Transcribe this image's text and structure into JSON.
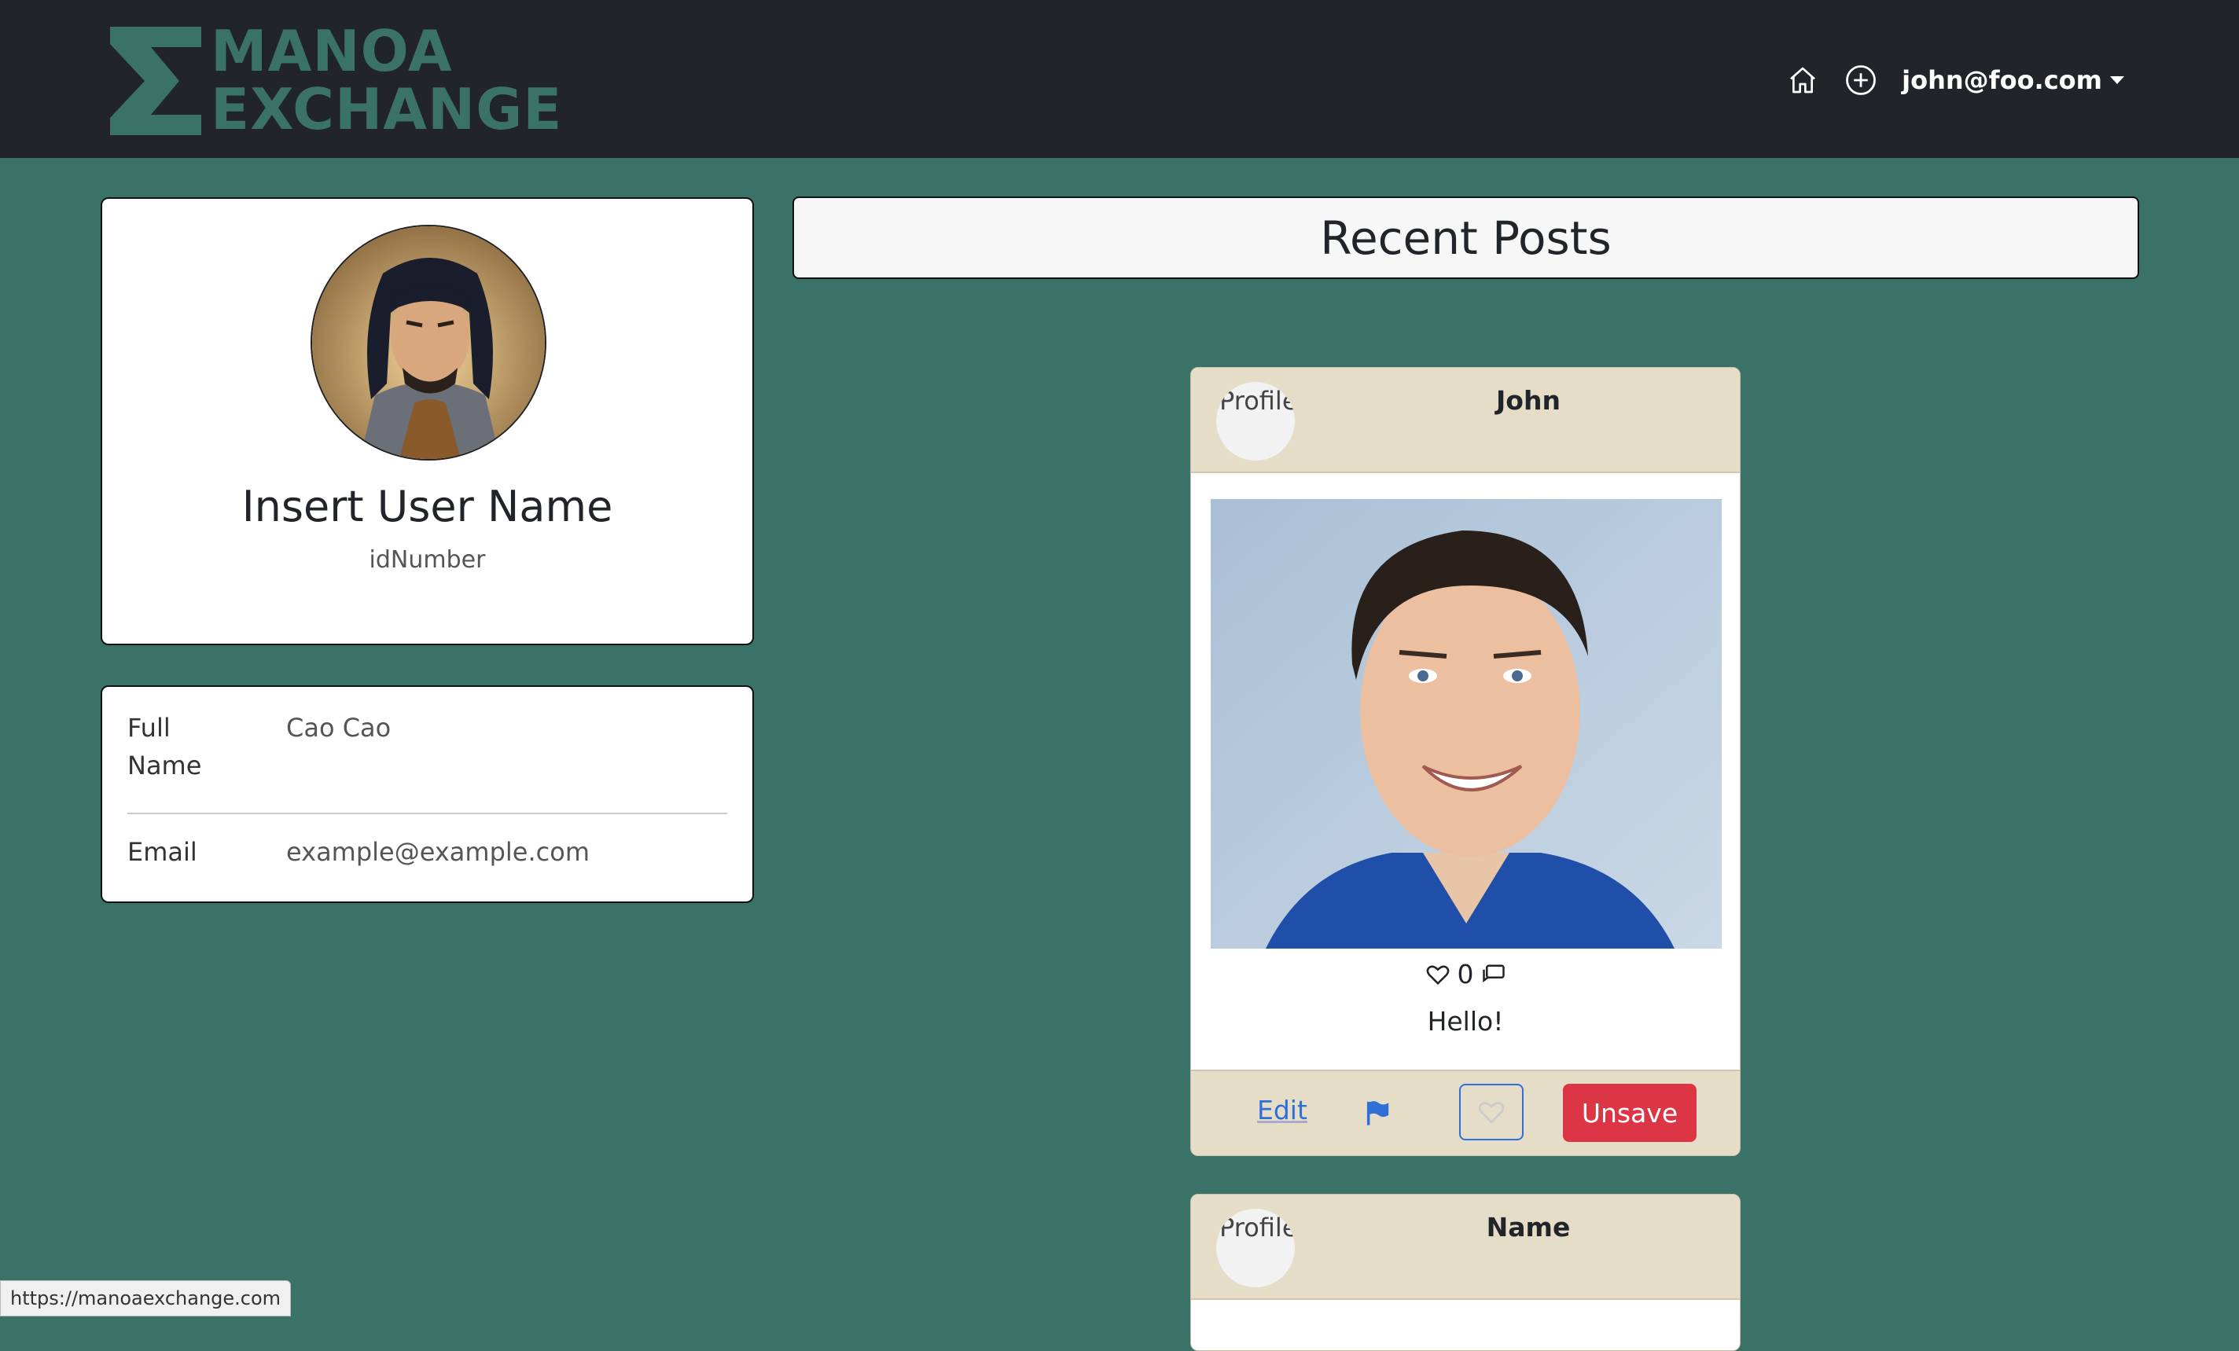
{
  "nav": {
    "logo_line1": "MANOA",
    "logo_line2": "EXCHANGE",
    "home_icon": "home-icon",
    "add_icon": "plus-circle-icon",
    "user_email": "john@foo.com"
  },
  "profile": {
    "name": "Insert User Name",
    "id": "idNumber",
    "full_name_label": "Full Name",
    "full_name_value": "Cao Cao",
    "email_label": "Email",
    "email_value": "example@example.com"
  },
  "recent": {
    "title": "Recent Posts"
  },
  "posts": [
    {
      "avatar_alt": "Profile",
      "author": "John",
      "likes": "0",
      "text": "Hello!",
      "edit_label": "Edit",
      "unsave_label": "Unsave"
    },
    {
      "avatar_alt": "Profile",
      "author": "Name"
    }
  ],
  "status_url": "https://manoaexchange.com",
  "colors": {
    "navbar": "#212529",
    "brand": "#3a7268",
    "card_header": "#e6ddc9",
    "danger": "#dc3545",
    "link": "#2f6fd8"
  }
}
